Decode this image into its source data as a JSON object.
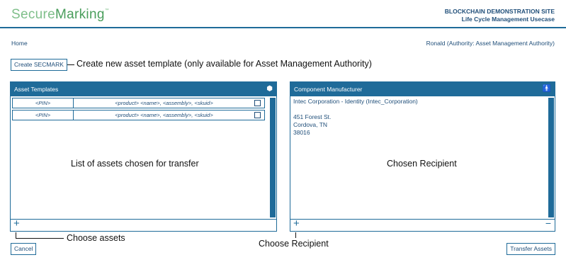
{
  "header": {
    "logo_part1": "Secure",
    "logo_part2": "Marking",
    "logo_tm": "™",
    "site_title": "BLOCKCHAIN DEMONSTRATION SITE",
    "site_subtitle": "Life Cycle Management Usecase"
  },
  "nav": {
    "home": "Home",
    "user": "Ronald (Authority: Asset Management Authority)"
  },
  "actions": {
    "create": "Create SECMARK",
    "cancel": "Cancel",
    "transfer": "Transfer Assets"
  },
  "annotations": {
    "create_note": "Create new asset template (only available for Asset Management Authority)",
    "list_note": "List of assets chosen for transfer",
    "recipient_note": "Chosen Recipient",
    "choose_assets": "Choose assets",
    "choose_recipient": "Choose Recipient"
  },
  "asset_panel": {
    "title": "Asset Templates",
    "icon": "cube-icon",
    "add": "+",
    "rows": [
      {
        "pin": "<PIN>",
        "desc": "<product> <name>,  <assembly>,  <skuid>"
      },
      {
        "pin": "<PIN>",
        "desc": "<product> <name>,  <assembly>,  <skuid>"
      }
    ]
  },
  "recipient_panel": {
    "title": "Component Manufacturer",
    "icon": "person-icon",
    "add": "+",
    "remove": "−",
    "name": "Intec Corporation - Identity (Intec_Corporation)",
    "street": "451 Forest St.",
    "city": "Cordova, TN",
    "zip": "38016"
  },
  "colors": {
    "primary": "#1f6b99",
    "text": "#1f4e79",
    "logo_light": "#7fbf8a",
    "logo_dark": "#4a9e5c"
  }
}
